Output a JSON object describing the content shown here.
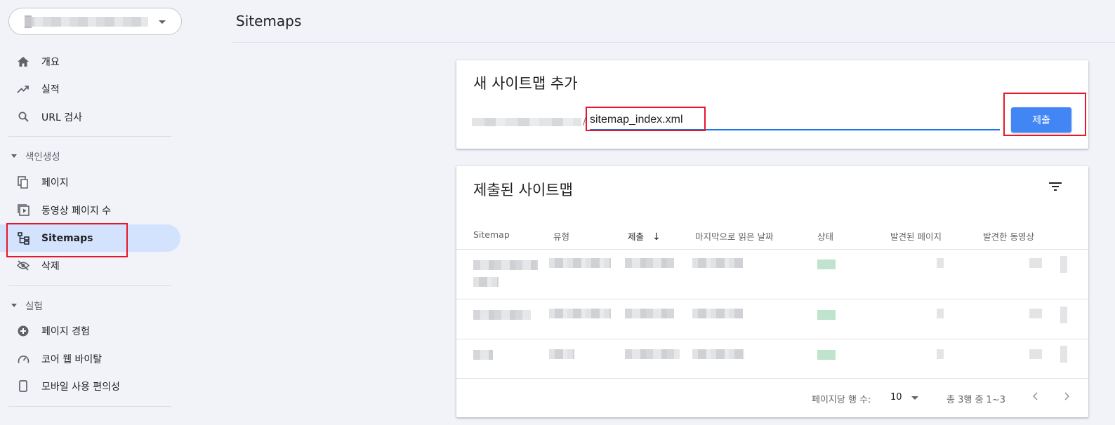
{
  "sidebar": {
    "nav_top": [
      {
        "label": "개요",
        "icon": "home-icon"
      },
      {
        "label": "실적",
        "icon": "trending-up-icon"
      },
      {
        "label": "URL 검사",
        "icon": "search-icon"
      }
    ],
    "section_index": "색인생성",
    "nav_index": [
      {
        "label": "페이지",
        "icon": "pages-icon"
      },
      {
        "label": "동영상 페이지 수",
        "icon": "video-pages-icon"
      },
      {
        "label": "Sitemaps",
        "icon": "sitemap-icon"
      },
      {
        "label": "삭제",
        "icon": "visibility-off-icon"
      }
    ],
    "section_experience": "실험",
    "nav_experience": [
      {
        "label": "페이지 경험",
        "icon": "plus-circle-icon"
      },
      {
        "label": "코어 웹 바이탈",
        "icon": "speedometer-icon"
      },
      {
        "label": "모바일 사용 편의성",
        "icon": "smartphone-icon"
      }
    ]
  },
  "header": {
    "title": "Sitemaps"
  },
  "add_card": {
    "title": "새 사이트맵 추가",
    "slash": "/",
    "input_value": "sitemap_index.xml",
    "submit_label": "제출"
  },
  "submitted_card": {
    "title": "제출된 사이트맵",
    "columns": [
      "Sitemap",
      "유형",
      "제출",
      "마지막으로 읽은 날짜",
      "상태",
      "발견된 페이지",
      "발견한 동영상"
    ],
    "sort_arrow": "↓",
    "rows_per_page_label": "페이지당 행 수:",
    "rows_per_page_value": "10",
    "range_text": "총 3행 중 1~3"
  },
  "colors": {
    "accent": "#4285f4",
    "active_nav": "#d3e3fd",
    "highlight_box": "#e8162a"
  }
}
